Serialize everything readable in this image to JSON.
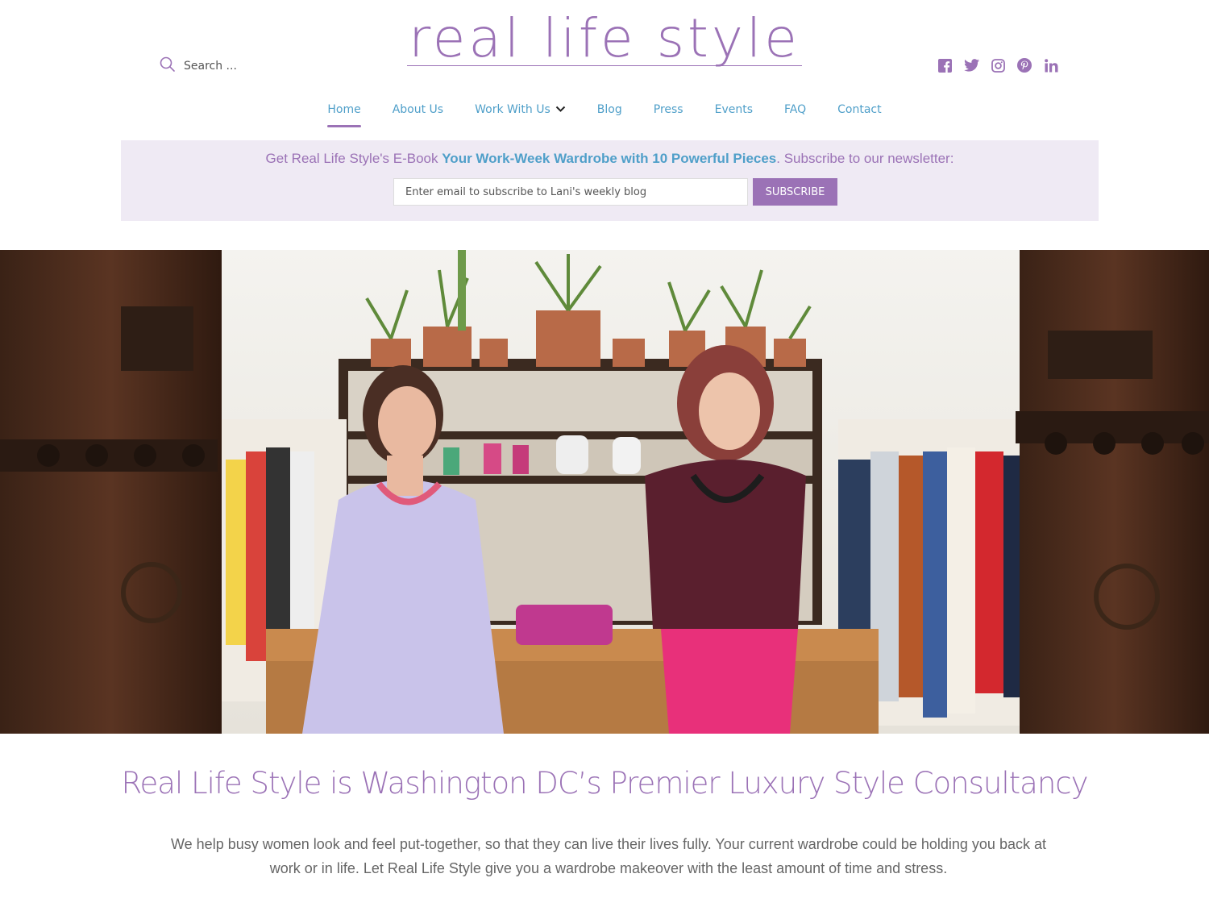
{
  "brand": {
    "logo_text": "real life style",
    "accent": "#9b72b6",
    "link": "#4f9fc9"
  },
  "search": {
    "placeholder": "Search ...",
    "icon": "search-icon"
  },
  "social": [
    "facebook-icon",
    "twitter-icon",
    "instagram-icon",
    "pinterest-icon",
    "linkedin-icon"
  ],
  "nav": {
    "items": [
      {
        "label": "Home",
        "active": true
      },
      {
        "label": "About Us"
      },
      {
        "label": "Work With Us",
        "has_dropdown": true
      },
      {
        "label": "Blog"
      },
      {
        "label": "Press"
      },
      {
        "label": "Events"
      },
      {
        "label": "FAQ"
      },
      {
        "label": "Contact"
      }
    ]
  },
  "newsletter": {
    "lead": "Get Real Life Style's E-Book ",
    "highlight": "Your Work-Week Wardrobe with 10 Powerful Pieces",
    "tail": ". Subscribe to our newsletter:",
    "placeholder": "Enter email to subscribe to Lani's weekly blog",
    "button": "SUBSCRIBE"
  },
  "main": {
    "headline": "Real Life Style is Washington DC’s Premier Luxury Style Consultancy",
    "body": "We help busy women look and feel put-together, so that they can live their lives fully. Your current wardrobe could be holding you back at work or in life. Let Real Life Style give you a wardrobe makeover with the least amount of time and stress."
  }
}
